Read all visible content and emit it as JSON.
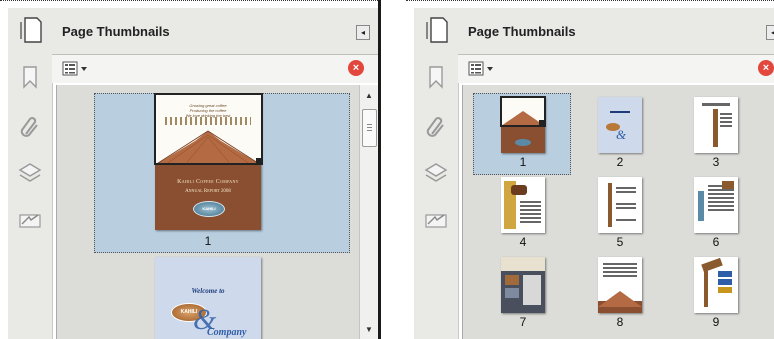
{
  "left_panel": {
    "title": "Page Thumbnails",
    "close_label": "×",
    "collapse_label": "◂",
    "pages": [
      {
        "number": "1",
        "cover_title": "Kahili Coffee Company",
        "cover_subtitle": "Annual Report 2008",
        "tagline_1": "Growing great coffee",
        "tagline_2": "Producing the coffee",
        "tagline_3": "We love drinking the best",
        "badge": "KAHILI"
      },
      {
        "number": "2",
        "welcome": "Welcome to",
        "badge": "KAHILI",
        "company": "Company"
      }
    ],
    "scroll_up": "▲",
    "scroll_down": "▼"
  },
  "right_panel": {
    "title": "Page Thumbnails",
    "close_label": "×",
    "collapse_label": "◂",
    "pages": [
      {
        "number": "1"
      },
      {
        "number": "2"
      },
      {
        "number": "3"
      },
      {
        "number": "4"
      },
      {
        "number": "5"
      },
      {
        "number": "6"
      },
      {
        "number": "7"
      },
      {
        "number": "8"
      },
      {
        "number": "9"
      }
    ]
  },
  "icons": {
    "sidebar": [
      "bookmark-icon",
      "attachment-icon",
      "layers-icon",
      "signature-icon"
    ],
    "header": "page-thumbnails-icon",
    "toolbar": "options-menu-icon"
  },
  "colors": {
    "selection": "#b9cfe0",
    "panel_bg": "#dcdcd9",
    "strip_bg": "#e9e9e6",
    "close_red": "#e2463c",
    "cover_brown": "#8a4f30"
  }
}
